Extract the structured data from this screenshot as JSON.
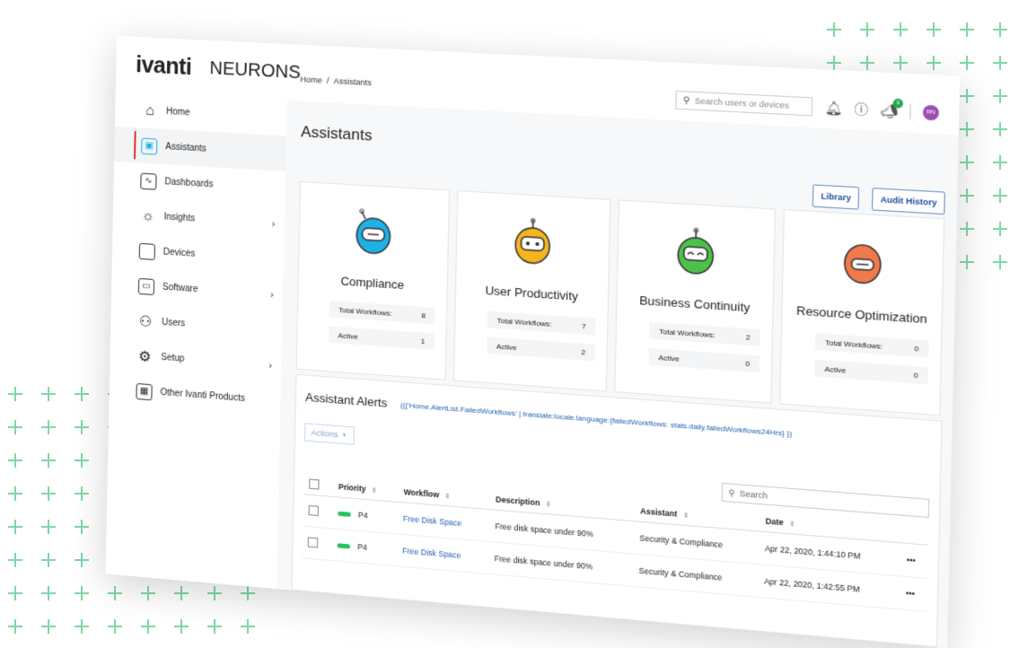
{
  "brand": {
    "ivanti": "ivanti",
    "neurons": "NEURONS"
  },
  "breadcrumb": {
    "home": "Home",
    "sep": "/",
    "current": "Assistants"
  },
  "header": {
    "search_placeholder": "Search users or devices",
    "notifications_count": "3",
    "avatar_initials": "RN"
  },
  "sidebar": {
    "items": [
      {
        "label": "Home"
      },
      {
        "label": "Assistants"
      },
      {
        "label": "Dashboards"
      },
      {
        "label": "Insights"
      },
      {
        "label": "Devices"
      },
      {
        "label": "Software"
      },
      {
        "label": "Users"
      },
      {
        "label": "Setup"
      },
      {
        "label": "Other Ivanti Products"
      }
    ]
  },
  "main": {
    "title": "Assistants",
    "library_label": "Library",
    "audit_label": "Audit History"
  },
  "cards": [
    {
      "name": "Compliance",
      "total_label": "Total Workflows:",
      "total": "8",
      "active_label": "Active",
      "active": "1",
      "color": "#1fb0e6"
    },
    {
      "name": "User Productivity",
      "total_label": "Total Workflows:",
      "total": "7",
      "active_label": "Active",
      "active": "2",
      "color": "#f5b51e"
    },
    {
      "name": "Business Continuity",
      "total_label": "Total Workflows:",
      "total": "2",
      "active_label": "Active",
      "active": "0",
      "color": "#4cc24a"
    },
    {
      "name": "Resource Optimization",
      "total_label": "Total Workflows:",
      "total": "0",
      "active_label": "Active",
      "active": "0",
      "color": "#f07a4b"
    }
  ],
  "alerts": {
    "title": "Assistant Alerts",
    "subtitle": "(({'Home.AlertList.FailedWorkflows' | translate:locale.language:{failedWorkflows: stats.daily.failedWorkflows24Hrs} })",
    "actions_label": "Actions",
    "search_placeholder": "Search",
    "columns": [
      "Priority",
      "Workflow",
      "Description",
      "Assistant",
      "Date"
    ],
    "rows": [
      {
        "priority": "P4",
        "workflow": "Free Disk Space",
        "description": "Free disk space under 90%",
        "assistant": "Security & Compliance",
        "date": "Apr 22, 2020, 1:44:10 PM",
        "more": "•••"
      },
      {
        "priority": "P4",
        "workflow": "Free Disk Space",
        "description": "Free disk space under 90%",
        "assistant": "Security & Compliance",
        "date": "Apr 22, 2020, 1:42:55 PM",
        "more": "•••"
      }
    ]
  }
}
